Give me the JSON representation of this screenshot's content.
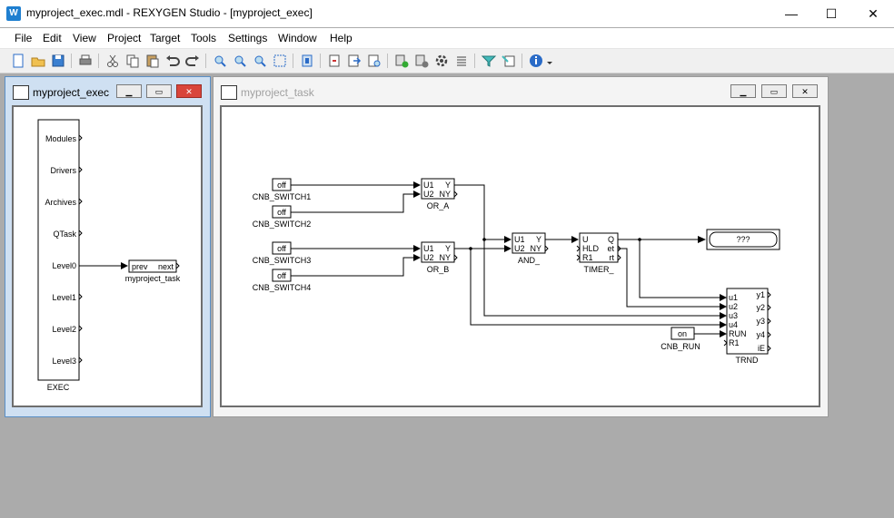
{
  "window": {
    "title": "myproject_exec.mdl - REXYGEN Studio - [myproject_exec]",
    "min_glyph": "—",
    "max_glyph": "☐",
    "close_glyph": "✕"
  },
  "menu": [
    "File",
    "Edit",
    "View",
    "Project",
    "Target",
    "Tools",
    "Settings",
    "Window",
    "Help"
  ],
  "toolbar_icons": [
    "new-icon",
    "open-icon",
    "save-icon",
    "print-icon",
    "cut-icon",
    "copy-icon",
    "paste-icon",
    "undo-icon",
    "redo-icon",
    "zoom-in-icon",
    "zoom-out-icon",
    "zoom-fit-icon",
    "zoom-select-icon",
    "compile-icon",
    "download-icon",
    "upload-icon",
    "connect-icon",
    "add-block-icon",
    "remove-block-icon",
    "settings-icon",
    "list-icon",
    "filter-icon",
    "trend-icon",
    "info-icon"
  ],
  "exec_window": {
    "title": "myproject_exec",
    "block_label": "EXEC",
    "ports": [
      "Modules",
      "Drivers",
      "Archives",
      "QTask",
      "Level0",
      "Level1",
      "Level2",
      "Level3"
    ],
    "task_block": {
      "left": "prev",
      "right": "next",
      "label": "myproject_task"
    }
  },
  "task_window": {
    "title": "myproject_task",
    "switches": [
      {
        "value": "off",
        "label": "CNB_SWITCH1"
      },
      {
        "value": "off",
        "label": "CNB_SWITCH2"
      },
      {
        "value": "off",
        "label": "CNB_SWITCH3"
      },
      {
        "value": "off",
        "label": "CNB_SWITCH4"
      }
    ],
    "or_a": {
      "label": "OR_A",
      "in1": "U1",
      "in2": "U2",
      "out1": "Y",
      "out2": "NY"
    },
    "or_b": {
      "label": "OR_B",
      "in1": "U1",
      "in2": "U2",
      "out1": "Y",
      "out2": "NY"
    },
    "and_block": {
      "label": "AND_",
      "in1": "U1",
      "in2": "U2",
      "out1": "Y",
      "out2": "NY"
    },
    "timer": {
      "label": "TIMER_",
      "in1": "U",
      "in2": "HLD",
      "in3": "R1",
      "out1": "Q",
      "out2": "et",
      "out3": "rt"
    },
    "display": {
      "value": "???"
    },
    "run_switch": {
      "value": "on",
      "label": "CNB_RUN"
    },
    "trend": {
      "label": "TRND",
      "inputs": [
        "u1",
        "u2",
        "u3",
        "u4",
        "RUN",
        "R1"
      ],
      "outputs": [
        "y1",
        "y2",
        "y3",
        "y4",
        "iE"
      ]
    }
  }
}
